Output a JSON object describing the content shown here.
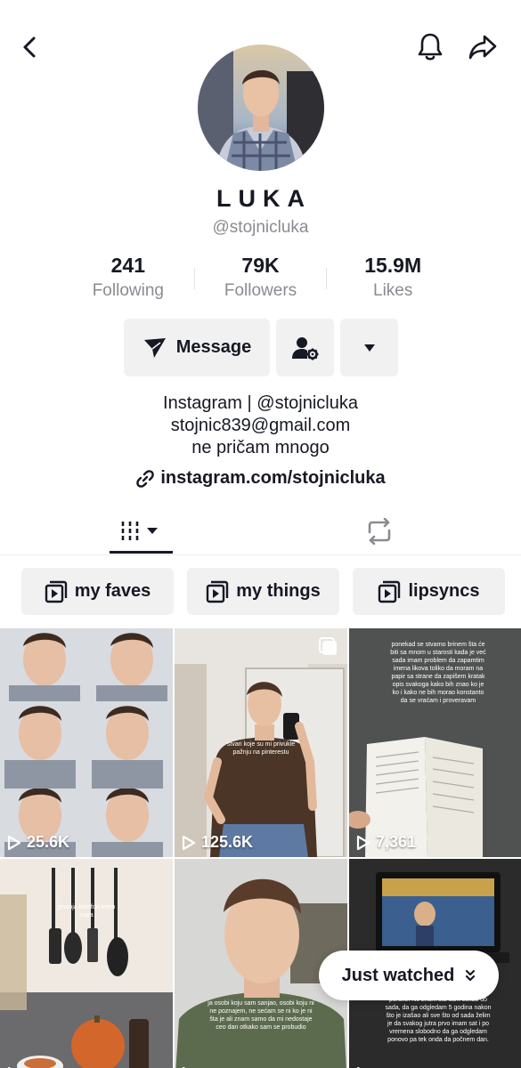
{
  "profile": {
    "name": "LUKA",
    "handle": "@stojnicluka",
    "bio_lines": [
      "Instagram | @stojnicluka",
      "stojnic839@gmail.com",
      "ne pričam mnogo"
    ],
    "link": "instagram.com/stojnicluka"
  },
  "stats": [
    {
      "value": "241",
      "label": "Following"
    },
    {
      "value": "79K",
      "label": "Followers"
    },
    {
      "value": "15.9M",
      "label": "Likes"
    }
  ],
  "actions": {
    "message_label": "Message"
  },
  "playlists": [
    "my faves",
    "my things",
    "lipsyncs"
  ],
  "videos": [
    {
      "views": "25.6K"
    },
    {
      "views": "125.6K",
      "caption": "stvari koje su mi privukle pažnju na pinterestu"
    },
    {
      "views": "7,361",
      "caption": "ponekad se stvarno brinem šta će biti sa mnom u starosti kada je već sada imam problem da zapamtim imena likova toliko da moram na papir sa strane da zapišem kratak opis svakoga kako bih znao ko je ko i kako ne bih morao konstanto da se vraćam i proveravam"
    },
    {
      "views": "",
      "caption": "jesenja komfort krem supa"
    },
    {
      "views": "",
      "caption": "ja osobi koju sam sanjao, osobi koju ni ne poznajem, ne sećam se ni ko je ni šta je ali znam samo da mi nedostaje ceo dan otkako sam se probudio"
    },
    {
      "views": "",
      "caption": "poruke. Ne znam šta sam čekao do sada, da ga odgledam 5 godina nakon što je izašao ali sve što od sada želim je da svakog jutra prvo imam sat i po vremena slobodno da ga odgledam ponovo pa tek onda da počnem dan."
    }
  ],
  "just_watched_label": "Just watched",
  "colors": {
    "text": "#161823",
    "muted": "#8a8b91",
    "button_bg": "#f1f1f2"
  },
  "icons": [
    "back-icon",
    "bell-icon",
    "share-icon",
    "message-send-icon",
    "person-gear-icon",
    "caret-down-icon",
    "link-icon",
    "grid-icon",
    "repost-icon",
    "playlist-icon",
    "play-icon",
    "pin-icon",
    "double-chevron-icon"
  ]
}
